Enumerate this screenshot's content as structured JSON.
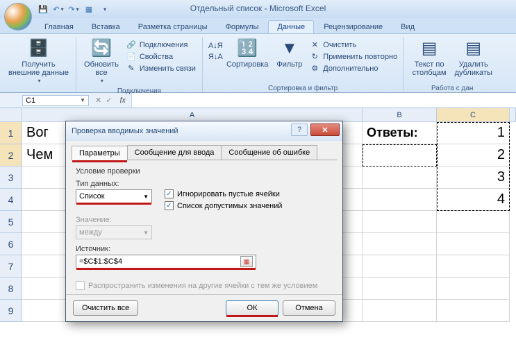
{
  "title": "Отдельный список - Microsoft Excel",
  "tabs": {
    "home": "Главная",
    "insert": "Вставка",
    "pagelayout": "Разметка страницы",
    "formulas": "Формулы",
    "data": "Данные",
    "review": "Рецензирование",
    "view": "Вид"
  },
  "ribbon": {
    "getExternal": "Получить\nвнешние данные",
    "refreshAll": "Обновить\nвсе",
    "connections": "Подключения",
    "properties": "Свойства",
    "editLinks": "Изменить связи",
    "groupConnections": "Подключения",
    "sortAZ": "А↓Я",
    "sortZA": "Я↓А",
    "sort": "Сортировка",
    "filter": "Фильтр",
    "clear": "Очистить",
    "reapply": "Применить повторно",
    "advanced": "Дополнительно",
    "groupSortFilter": "Сортировка и фильтр",
    "textToCols": "Текст по\nстолбцам",
    "removeDup": "Удалить\nдубликаты",
    "groupDataTools": "Работа с дан"
  },
  "namebox": "C1",
  "columns": {
    "A": "A",
    "B": "B",
    "C": "C"
  },
  "cells": {
    "A1": "Вог",
    "A2": "Чем",
    "B1": "Ответы:",
    "C1": "1",
    "C2": "2",
    "C3": "3",
    "C4": "4"
  },
  "rows": [
    "1",
    "2",
    "3",
    "4",
    "5",
    "6",
    "7",
    "8",
    "9"
  ],
  "dialog": {
    "title": "Проверка вводимых значений",
    "tabs": {
      "params": "Параметры",
      "input": "Сообщение для ввода",
      "error": "Сообщение об ошибке"
    },
    "groupLabel": "Условие проверки",
    "typeLabel": "Тип данных:",
    "typeValue": "Список",
    "ignoreBlank": "Игнорировать пустые ячейки",
    "inCell": "Список допустимых значений",
    "valueLabel": "Значение:",
    "valueValue": "между",
    "sourceLabel": "Источник:",
    "sourceValue": "=$C$1:$C$4",
    "propagate": "Распространить изменения на другие ячейки с тем же условием",
    "clearAll": "Очистить все",
    "ok": "ОК",
    "cancel": "Отмена"
  }
}
